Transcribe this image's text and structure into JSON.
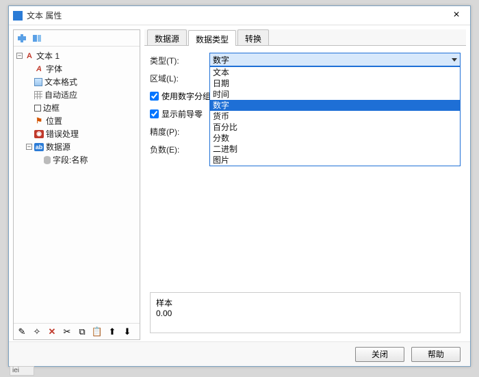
{
  "window": {
    "title": "文本 属性"
  },
  "tree": {
    "root": {
      "label": "文本 1"
    },
    "items": [
      {
        "label": "字体"
      },
      {
        "label": "文本格式"
      },
      {
        "label": "自动适应"
      },
      {
        "label": "边框"
      },
      {
        "label": "位置"
      },
      {
        "label": "错误处理"
      },
      {
        "label": "数据源"
      }
    ],
    "child": {
      "label": "字段:名称"
    }
  },
  "tabs": {
    "t0": "数据源",
    "t1": "数据类型",
    "t2": "转换"
  },
  "form": {
    "type_label": "类型(T):",
    "type_value": "数字",
    "region_label": "区域(L):",
    "cb_group_label": "使用数字分组",
    "cb_leadzero_label": "显示前导零",
    "precision_label": "精度(P):",
    "negative_label": "负数(E):"
  },
  "dropdown": {
    "o0": "文本",
    "o1": "日期",
    "o2": "时间",
    "o3": "数字",
    "o4": "货币",
    "o5": "百分比",
    "o6": "分数",
    "o7": "二进制",
    "o8": "图片"
  },
  "sample": {
    "label": "样本",
    "value": "0.00"
  },
  "buttons": {
    "close": "关闭",
    "help": "帮助"
  },
  "status": {
    "text": "iei"
  }
}
